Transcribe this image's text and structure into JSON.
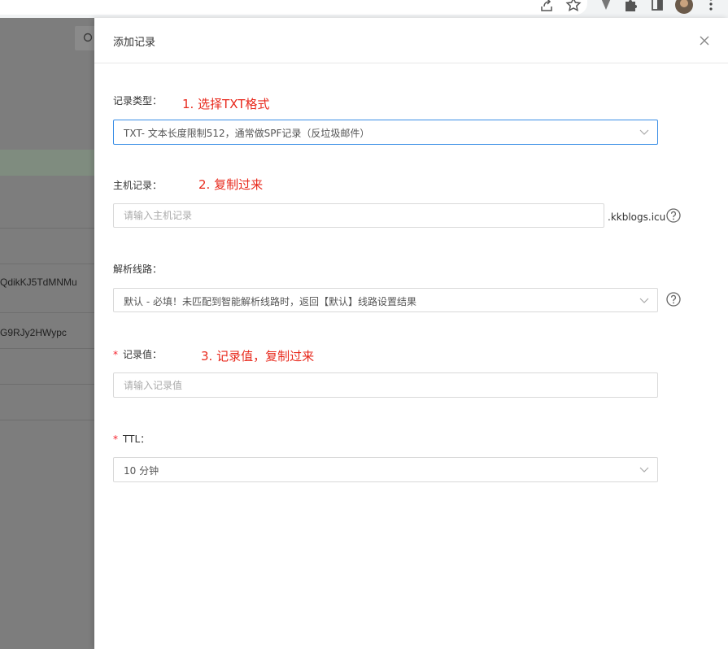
{
  "browser": {
    "icons": [
      "share-icon",
      "star-icon",
      "extension-v-icon",
      "puzzle-icon",
      "sidepanel-icon",
      "avatar",
      "more-icon"
    ]
  },
  "background": {
    "rows": [
      "QdikKJ5TdMNMu",
      "G9RJy2HWypc"
    ]
  },
  "drawer": {
    "title": "添加记录"
  },
  "form": {
    "record_type": {
      "label": "记录类型：",
      "value": "TXT- 文本长度限制512，通常做SPF记录（反垃圾邮件）",
      "annotation": "1. 选择TXT格式"
    },
    "host": {
      "label": "主机记录：",
      "placeholder": "请输入主机记录",
      "suffix": ".kkblogs.icu",
      "annotation": "2. 复制过来"
    },
    "line": {
      "label": "解析线路：",
      "value": "默认 - 必填！未匹配到智能解析线路时，返回【默认】线路设置结果"
    },
    "record_value": {
      "required_mark": "*",
      "label": "记录值：",
      "placeholder": "请输入记录值",
      "annotation": "3. 记录值，复制过来"
    },
    "ttl": {
      "required_mark": "*",
      "label": "TTL：",
      "value": "10 分钟"
    }
  },
  "colors": {
    "accent_border": "#3a8ee6",
    "annotation_red": "#e8291c",
    "required_red": "#f5222d",
    "overlay": "#7d7d7d"
  }
}
